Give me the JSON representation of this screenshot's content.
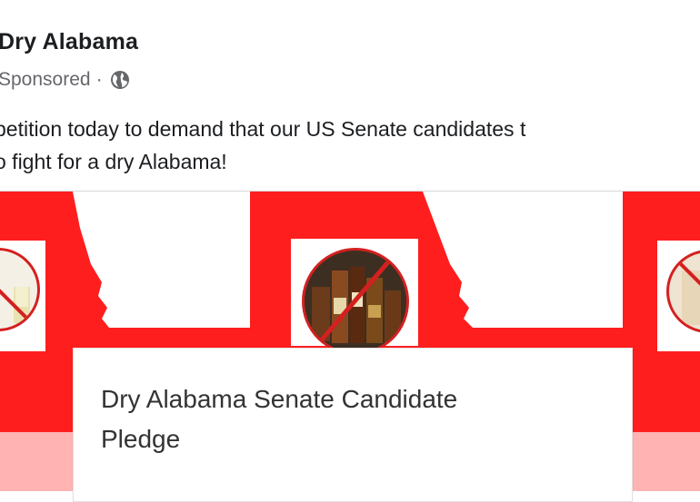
{
  "post": {
    "page_name": "Dry Alabama",
    "sponsored_label": "Sponsored",
    "separator": "·",
    "audience_icon": "globe-icon",
    "text_line1": "petition today to demand that our US Senate candidates t",
    "text_line2": "o fight for a dry Alabama!"
  },
  "ad": {
    "pledge_title_line1": "Dry Alabama Senate Candidate",
    "pledge_title_line2": "Pledge",
    "icons": [
      "no-wine-icon",
      "no-liquor-icon",
      "no-beer-icon"
    ]
  },
  "colors": {
    "brand_red": "#ff1e1e",
    "prohibition_red": "#d42020",
    "text_primary": "#1c1e21",
    "text_secondary": "#65676b"
  }
}
